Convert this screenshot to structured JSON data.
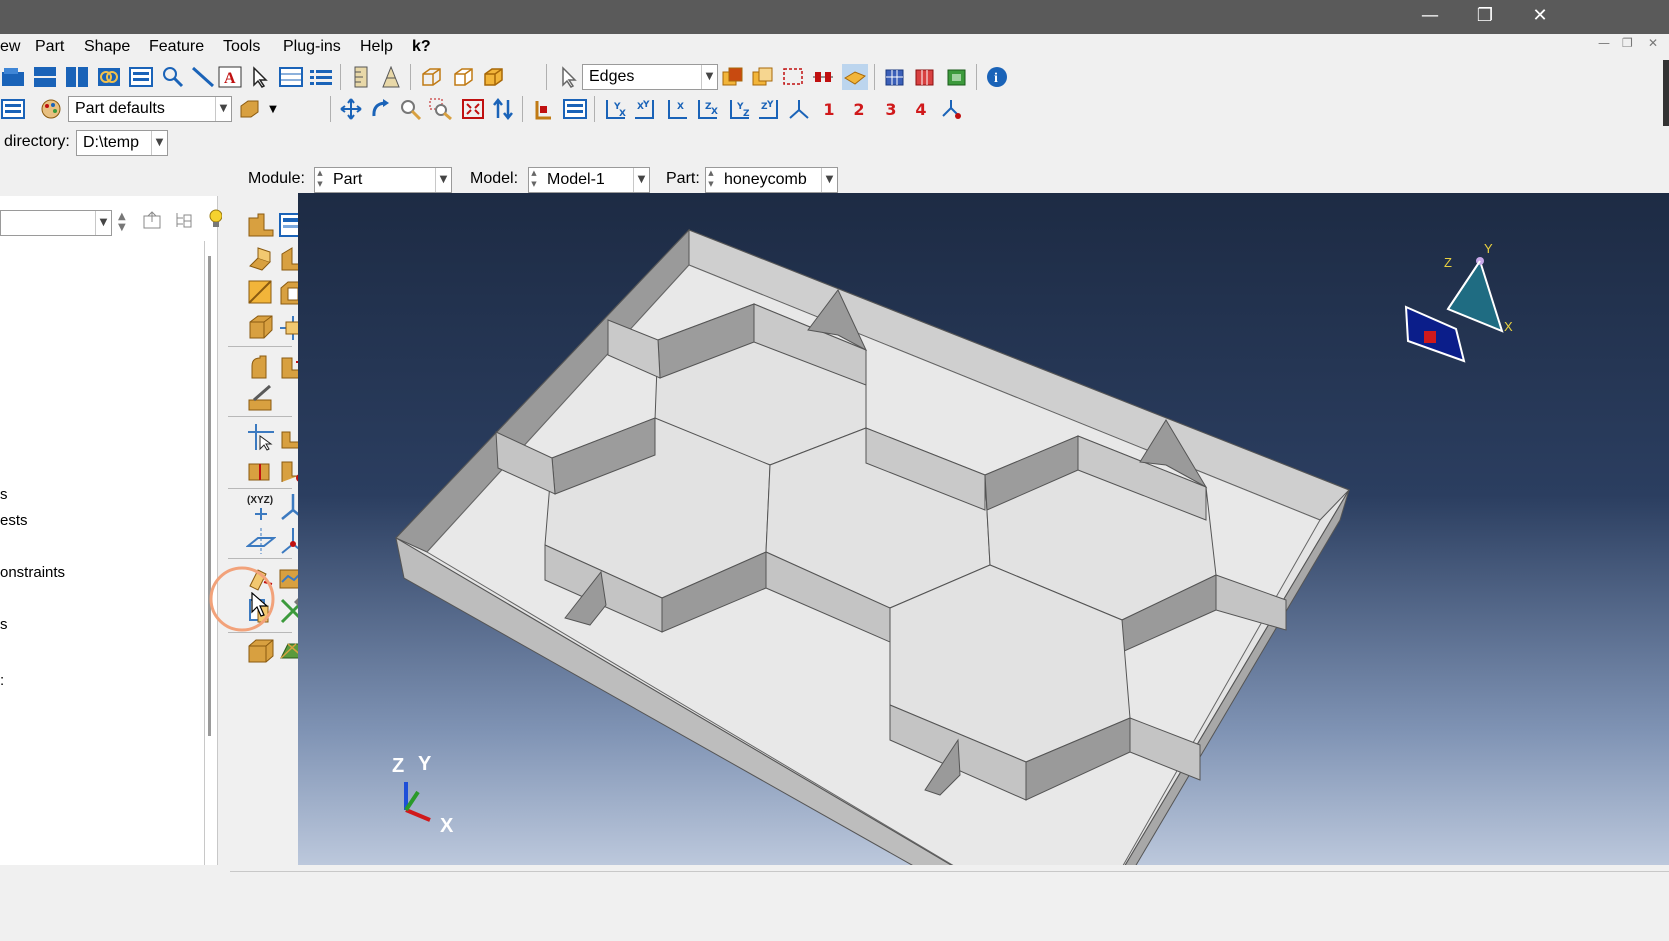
{
  "window": {
    "minimize_icon": "minimize-icon",
    "restore_icon": "restore-icon",
    "close_icon": "close-icon"
  },
  "menu": {
    "items": [
      "ew",
      "Part",
      "Shape",
      "Feature",
      "Tools",
      "Plug-ins",
      "Help"
    ],
    "whats_this": "k?"
  },
  "toolbar": {
    "selection_filter": "Edges",
    "part_defaults": "Part defaults",
    "directory_label": "directory:",
    "directory_value": "D:\\temp",
    "view_numbers": [
      "1",
      "2",
      "3",
      "4"
    ]
  },
  "context": {
    "module_label": "Module:",
    "module_value": "Part",
    "model_label": "Model:",
    "model_value": "Model-1",
    "part_label": "Part:",
    "part_value": "honeycomb"
  },
  "tree": {
    "items": [
      "s",
      "ests",
      "onstraints",
      "s",
      ":"
    ]
  },
  "triad": {
    "x": "X",
    "y": "Y",
    "z": "Z"
  },
  "view_triad": {
    "x": "X",
    "y": "Y",
    "z": "Z"
  },
  "colors": {
    "accent_red": "#d0191b",
    "toolbar_blue": "#1a63b8",
    "highlight_ring": "#f2a27a",
    "viewport_top": "#1d2b44",
    "viewport_bottom": "#bcc8dc"
  }
}
